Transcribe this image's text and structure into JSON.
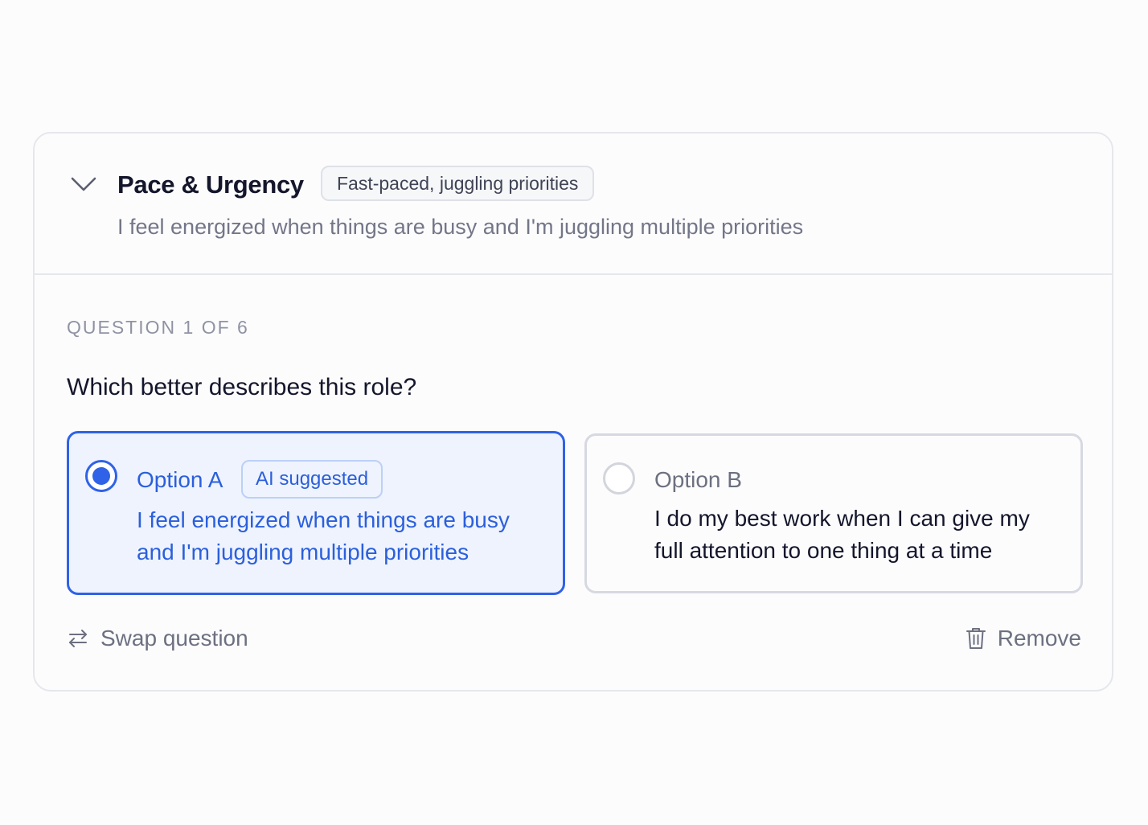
{
  "section": {
    "title": "Pace & Urgency",
    "tag": "Fast-paced, juggling priorities",
    "subtitle": "I feel energized when things are busy and I'm juggling multiple priorities",
    "expanded": true
  },
  "question": {
    "counter": "QUESTION 1 OF 6",
    "prompt": "Which better describes this role?",
    "options": [
      {
        "label": "Option A",
        "badge": "AI suggested",
        "text": "I feel energized when things are busy and I'm juggling multiple priorities",
        "selected": true
      },
      {
        "label": "Option B",
        "text": "I do my best work when I can give my full attention to one thing at a time",
        "selected": false
      }
    ]
  },
  "actions": {
    "swap_label": "Swap question",
    "remove_label": "Remove"
  },
  "colors": {
    "accent": "#2f62e6",
    "selected_bg": "#eef3fd",
    "border": "#e6e7ec",
    "text_primary": "#14162b",
    "text_muted": "#737687"
  },
  "icons": {
    "collapse": "chevron-down-icon",
    "swap": "swap-arrows-icon",
    "remove": "trash-icon"
  }
}
